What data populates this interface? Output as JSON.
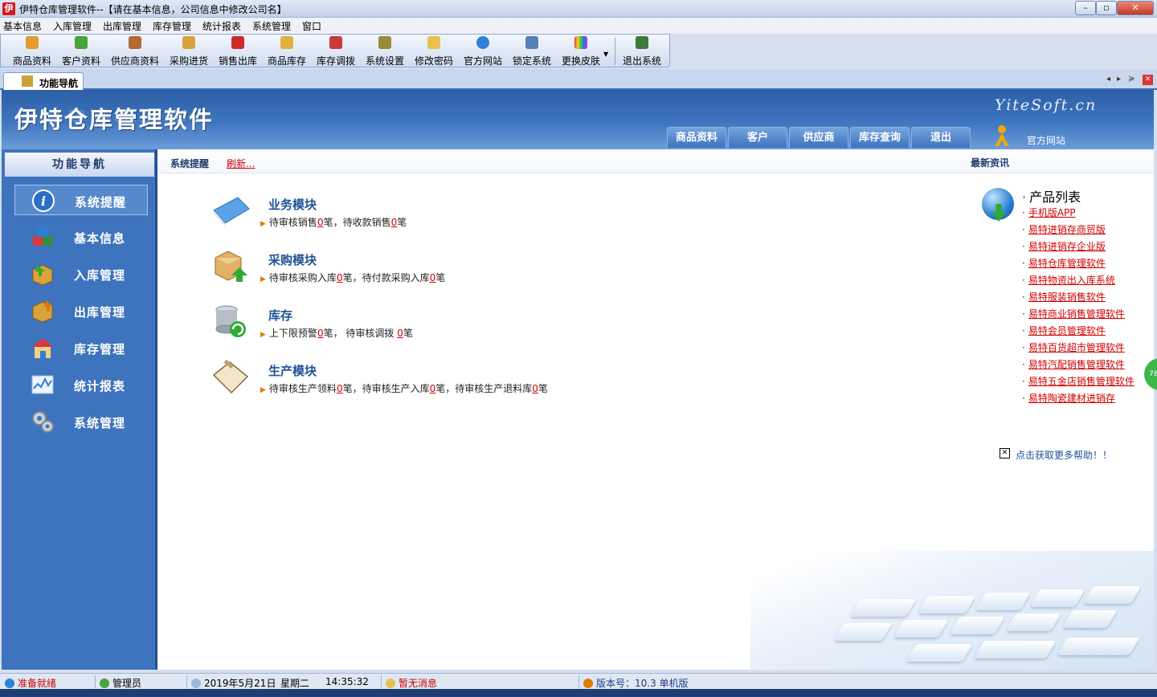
{
  "window": {
    "app_icon": "伊",
    "title": "伊特仓库管理软件--【请在基本信息，公司信息中修改公司名】",
    "min": "–",
    "max": "▫",
    "close": "✕"
  },
  "menu": [
    "基本信息",
    "入库管理",
    "出库管理",
    "库存管理",
    "统计报表",
    "系统管理",
    "窗口"
  ],
  "toolbar": [
    {
      "label": "商品资料",
      "icon": "product-icon",
      "color": "#e49b2f"
    },
    {
      "label": "客户资料",
      "icon": "customer-icon",
      "color": "#4aa33d"
    },
    {
      "label": "供应商资料",
      "icon": "supplier-icon",
      "color": "#b56a33"
    },
    {
      "label": "采购进货",
      "icon": "purchase-icon",
      "color": "#d9a23a"
    },
    {
      "label": "销售出库",
      "icon": "sale-icon",
      "color": "#cc2a2a"
    },
    {
      "label": "商品库存",
      "icon": "stock-icon",
      "color": "#e0b040"
    },
    {
      "label": "库存调拨",
      "icon": "transfer-icon",
      "color": "#c83b3b"
    },
    {
      "label": "系统设置",
      "icon": "settings-icon",
      "color": "#9a8a3a"
    },
    {
      "label": "修改密码",
      "icon": "password-icon",
      "color": "#e8c050"
    },
    {
      "label": "官方网站",
      "icon": "ie-icon",
      "color": "#2f7fd6"
    },
    {
      "label": "锁定系统",
      "icon": "lock-icon",
      "color": "#5a7fb8"
    },
    {
      "label": "更换皮肤",
      "icon": "skin-icon",
      "color": "#b050c0"
    },
    {
      "label": "退出系统",
      "icon": "exit-icon",
      "color": "#3d7a3d"
    }
  ],
  "tabstrip": {
    "tab_label": "功能导航",
    "prev": "◂",
    "next": "▸",
    "more": "≽",
    "close": "✕"
  },
  "banner": {
    "title": "伊特仓库管理软件",
    "brand": "YiteSoft.cn",
    "nav_tabs": [
      "商品资料",
      "客户",
      "供应商",
      "库存查询",
      "退出"
    ],
    "site_link": "官方网站"
  },
  "sidebar": {
    "header": "功能导航",
    "items": [
      {
        "label": "系统提醒",
        "icon": "info-icon",
        "active": true
      },
      {
        "label": "基本信息",
        "icon": "cubes-icon",
        "active": false
      },
      {
        "label": "入库管理",
        "icon": "inbound-box-icon",
        "active": false
      },
      {
        "label": "出库管理",
        "icon": "outbound-box-icon",
        "active": false
      },
      {
        "label": "库存管理",
        "icon": "warehouse-icon",
        "active": false
      },
      {
        "label": "统计报表",
        "icon": "chart-icon",
        "active": false
      },
      {
        "label": "系统管理",
        "icon": "gears-icon",
        "active": false
      }
    ]
  },
  "content": {
    "bar_title": "系统提醒",
    "refresh": "刷新...",
    "news_title": "最新资讯",
    "modules": [
      {
        "name": "业务模块",
        "icon": "book-icon",
        "parts": [
          "待审核销售",
          "0",
          "笔，待收款销售",
          "0",
          "笔"
        ]
      },
      {
        "name": "采购模块",
        "icon": "box-upload-icon",
        "parts": [
          "待审核采购入库",
          "0",
          "笔，待付款采购入库",
          "0",
          "笔"
        ]
      },
      {
        "name": "库存",
        "icon": "database-icon",
        "parts": [
          "上下限预警",
          "0",
          "笔，   待审核调拨 ",
          "0",
          "笔"
        ]
      },
      {
        "name": "生产模块",
        "icon": "clipboard-icon",
        "parts": [
          "待审核生产领料",
          "0",
          "笔，待审核生产入库",
          "0",
          "笔，待审核生产退料库",
          "0",
          "笔"
        ]
      }
    ],
    "product_list_title": "产品列表",
    "products": [
      "手机版APP",
      "易特进销存商贸版",
      "易特进销存企业版",
      "易特仓库管理软件",
      "易特物资出入库系统",
      "易特服装销售软件",
      "易特商业销售管理软件",
      "易特会员管理软件",
      "易特百货超市管理软件",
      "易特汽配销售管理软件",
      "易特五金店销售管理软件",
      "易特陶瓷建材进销存"
    ],
    "help_icon": "✕",
    "help_link": "点击获取更多帮助！！",
    "edge_badge": "78"
  },
  "status": {
    "ready": "准备就绪",
    "user": "管理员",
    "date": "2019年5月21日",
    "weekday": "星期二",
    "time": "14:35:32",
    "message": "暂无消息",
    "version": "版本号：10.3 单机版"
  },
  "colors": {
    "accent": "#3e74bd",
    "link_red": "#d10000",
    "title_blue": "#1f5294"
  }
}
